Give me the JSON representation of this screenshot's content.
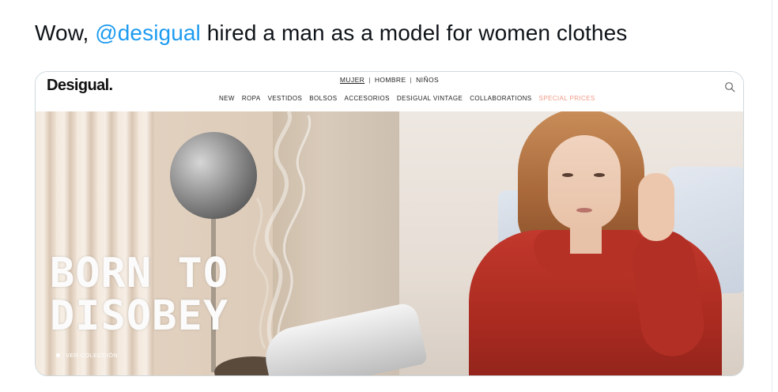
{
  "tweet": {
    "text_before": "Wow, ",
    "mention": "@desigual",
    "text_after": " hired a man as a model for women clothes"
  },
  "site": {
    "logo": "Desigual.",
    "gender_nav": [
      "MUJER",
      "HOMBRE",
      "NIÑOS"
    ],
    "gender_separator": "|",
    "active_gender": "MUJER",
    "main_nav": [
      "NEW",
      "ROPA",
      "VESTIDOS",
      "BOLSOS",
      "ACCESORIOS",
      "DESIGUAL VINTAGE",
      "COLLABORATIONS",
      "SPECIAL PRICES"
    ],
    "special_nav_color": "#ef9a86"
  },
  "hero": {
    "title_line1": "BORN TO",
    "title_line2": "DISOBEY",
    "cta": "VER COLECCIÓN"
  },
  "colors": {
    "mention": "#1d9bf0",
    "text": "#0f1419",
    "card_border": "#cfd9de"
  }
}
